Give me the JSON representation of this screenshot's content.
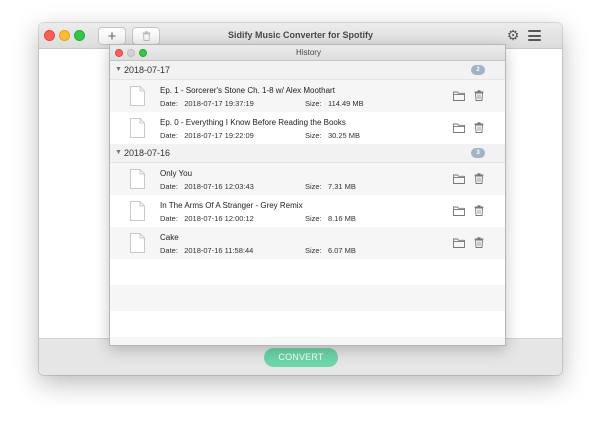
{
  "main": {
    "title": "Sidify Music Converter for Spotify",
    "add_label": "+",
    "convert_label": "CONVERT"
  },
  "history": {
    "title": "History",
    "date_label": "Date:",
    "size_label": "Size:",
    "groups": [
      {
        "date": "2018-07-17",
        "count": "2",
        "items": [
          {
            "title": "Ep. 1 - Sorcerer's Stone Ch. 1-8 w/ Alex Moothart",
            "date": "2018-07-17 19:37:19",
            "size": "114.49 MB"
          },
          {
            "title": "Ep. 0 - Everything I Know Before Reading the Books",
            "date": "2018-07-17 19:22:09",
            "size": "30.25 MB"
          }
        ]
      },
      {
        "date": "2018-07-16",
        "count": "3",
        "items": [
          {
            "title": "Only You",
            "date": "2018-07-16 12:03:43",
            "size": "7.31 MB"
          },
          {
            "title": "In The Arms Of A Stranger - Grey Remix",
            "date": "2018-07-16 12:00:12",
            "size": "8.16 MB"
          },
          {
            "title": "Cake",
            "date": "2018-07-16 11:58:44",
            "size": "6.07 MB"
          }
        ]
      }
    ]
  },
  "colors": {
    "convert": "#6dd6a9",
    "badge": "#a3b3c7",
    "close": "#fc5f57",
    "minimize": "#fdbc2e",
    "zoom": "#33c748"
  },
  "icons": [
    "gear-icon",
    "menu-icon",
    "trash-icon",
    "folder-icon",
    "file-icon",
    "triangle-down-icon"
  ]
}
